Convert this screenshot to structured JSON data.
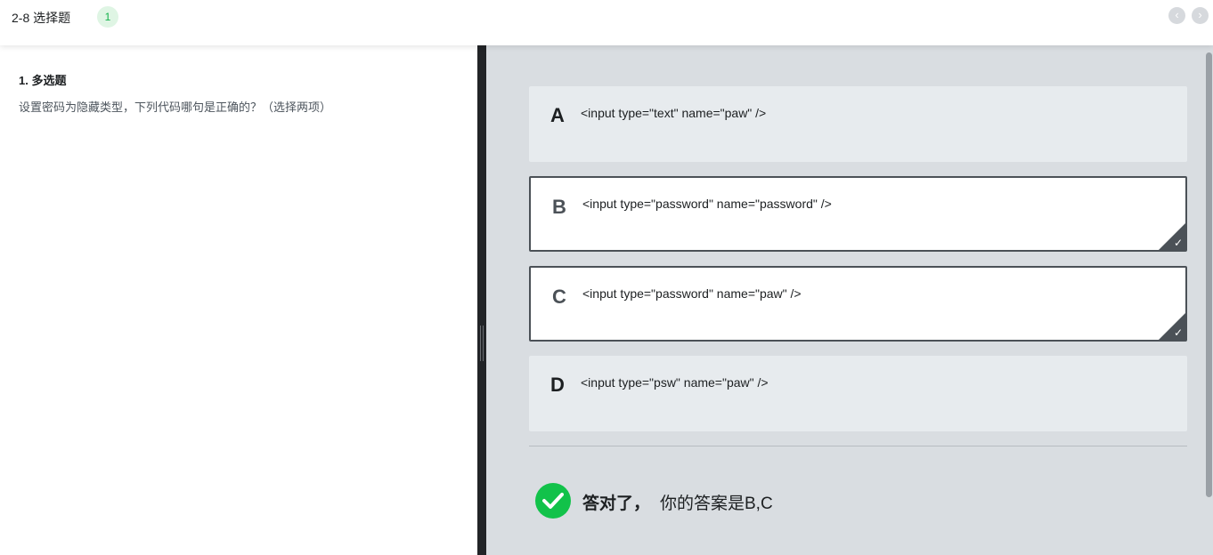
{
  "header": {
    "title": "2-8 选择题",
    "badge": "1",
    "prev_icon": "chevron-left-icon",
    "next_icon": "chevron-right-icon"
  },
  "question": {
    "type_label": "1. 多选题",
    "text": "设置密码为隐藏类型，下列代码哪句是正确的？（选择两项）"
  },
  "options": [
    {
      "letter": "A",
      "code": "<input type=\"text\" name=\"paw\" />",
      "selected": false
    },
    {
      "letter": "B",
      "code": "<input type=\"password\" name=\"password\" />",
      "selected": true
    },
    {
      "letter": "C",
      "code": "<input type=\"password\" name=\"paw\" />",
      "selected": true
    },
    {
      "letter": "D",
      "code": "<input type=\"psw\" name=\"paw\" />",
      "selected": false
    }
  ],
  "result": {
    "status_text": "答对了，",
    "answer_text": "你的答案是B,C",
    "icon": "check-circle-icon",
    "color": "#12c24a"
  },
  "colors": {
    "accent_green": "#12c24a",
    "selected_border": "#4b5157",
    "panel_bg": "#d9dde1",
    "option_bg": "#e7ebee"
  }
}
